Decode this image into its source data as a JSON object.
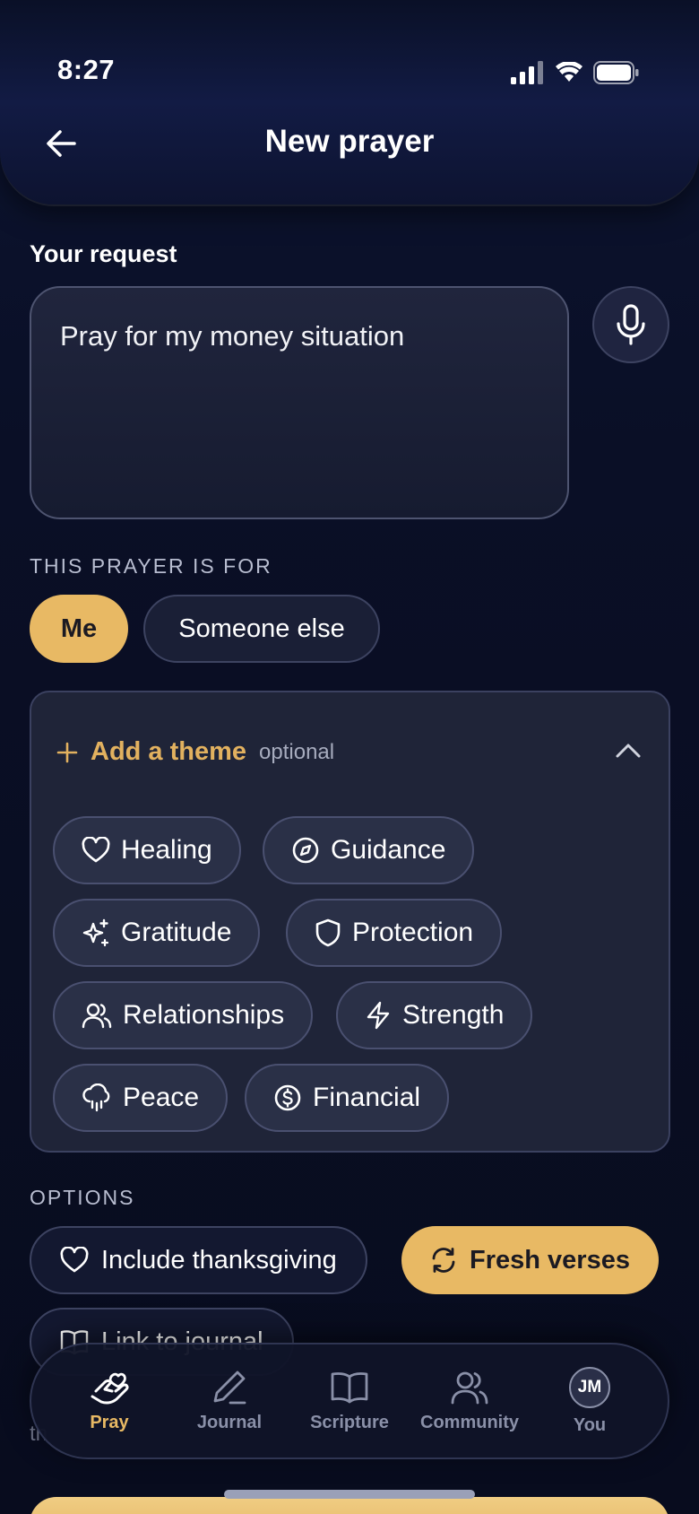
{
  "status_bar": {
    "time": "8:27"
  },
  "header": {
    "title": "New prayer"
  },
  "request": {
    "label": "Your request",
    "value": "Pray for my money situation"
  },
  "prayer_for": {
    "label": "THIS PRAYER IS FOR",
    "options": [
      {
        "label": "Me",
        "selected": true
      },
      {
        "label": "Someone else",
        "selected": false
      }
    ]
  },
  "theme": {
    "title": "Add a theme",
    "optional": "optional",
    "chips": [
      {
        "label": "Healing",
        "icon": "heart-icon"
      },
      {
        "label": "Guidance",
        "icon": "compass-icon"
      },
      {
        "label": "Gratitude",
        "icon": "sparkles-icon"
      },
      {
        "label": "Protection",
        "icon": "shield-icon"
      },
      {
        "label": "Relationships",
        "icon": "users-icon"
      },
      {
        "label": "Strength",
        "icon": "lightning-icon"
      },
      {
        "label": "Peace",
        "icon": "cloud-rain-icon"
      },
      {
        "label": "Financial",
        "icon": "dollar-circle-icon"
      }
    ]
  },
  "options": {
    "label": "OPTIONS",
    "items": [
      {
        "label": "Include thanksgiving",
        "icon": "heart-icon",
        "selected": false
      },
      {
        "label": "Fresh verses",
        "icon": "refresh-icon",
        "selected": true
      },
      {
        "label": "Link to journal",
        "icon": "book-icon",
        "selected": false
      }
    ]
  },
  "nav": {
    "items": [
      {
        "label": "Pray",
        "icon": "praying-hands-icon",
        "active": true
      },
      {
        "label": "Journal",
        "icon": "pencil-icon",
        "active": false
      },
      {
        "label": "Scripture",
        "icon": "open-book-icon",
        "active": false
      },
      {
        "label": "Community",
        "icon": "users-icon",
        "active": false
      },
      {
        "label": "You",
        "avatar_initials": "JM",
        "active": false
      }
    ]
  },
  "obscured_text": "th",
  "colors": {
    "accent_gold": "#e8b964",
    "background": "#0b1024",
    "card": "#1f2438"
  }
}
